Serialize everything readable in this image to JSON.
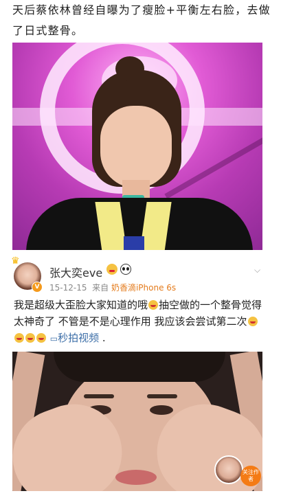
{
  "article": {
    "intro_text": "天后蔡依林曾经自曝为了瘦脸+平衡左右脸，去做了日式整骨。"
  },
  "post": {
    "username": "张大奕eve",
    "date": "15-12-15",
    "source_prefix": "来自",
    "source": "奶香滴iPhone 6s",
    "text_part1": "我是超级大歪脸大家知道的哦",
    "text_part2": "抽空做的一个整骨觉得太神奇了 不管是不是心理作用 我应该会尝试第二次",
    "video_label": "秒拍视频",
    "trailing": " .",
    "verified_badge": "V"
  },
  "follow": {
    "label": "关注作者"
  },
  "icons": {
    "crown": "crown-icon",
    "chevron": "chevron-down-icon",
    "video": "video-icon"
  },
  "colors": {
    "accent_orange": "#f47b15",
    "link_blue": "#3d6fa8"
  }
}
